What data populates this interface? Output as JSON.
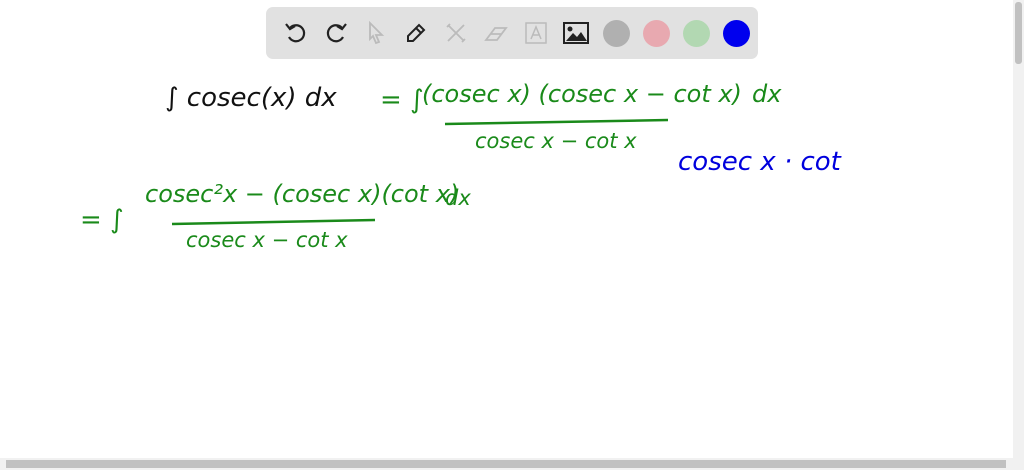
{
  "toolbar": {
    "tools": [
      "undo-icon",
      "redo-icon",
      "select-icon",
      "pen-icon",
      "tools-icon",
      "eraser-icon",
      "text-icon",
      "image-icon"
    ],
    "colors": [
      "#b0b0b0",
      "#e8a9b0",
      "#b2d8b2",
      "#0000ee"
    ]
  },
  "board": {
    "line1": {
      "lhs": "∫ cosec(x) dx",
      "color": "#111111"
    },
    "line2": {
      "eq": "= ∫",
      "numerator": "(cosec x) (cosec x − cot x)",
      "denominator": "cosec x − cot x",
      "dx": "dx",
      "color": "#1a8a1a"
    },
    "note": {
      "text": "cosec x · cot",
      "color": "#0000dd"
    },
    "line3": {
      "eq": "= ∫",
      "numerator": "cosec²x − (cosec x)(cot x)",
      "denominator": "cosec x − cot x",
      "dx": "dx",
      "color": "#1a8a1a"
    }
  }
}
